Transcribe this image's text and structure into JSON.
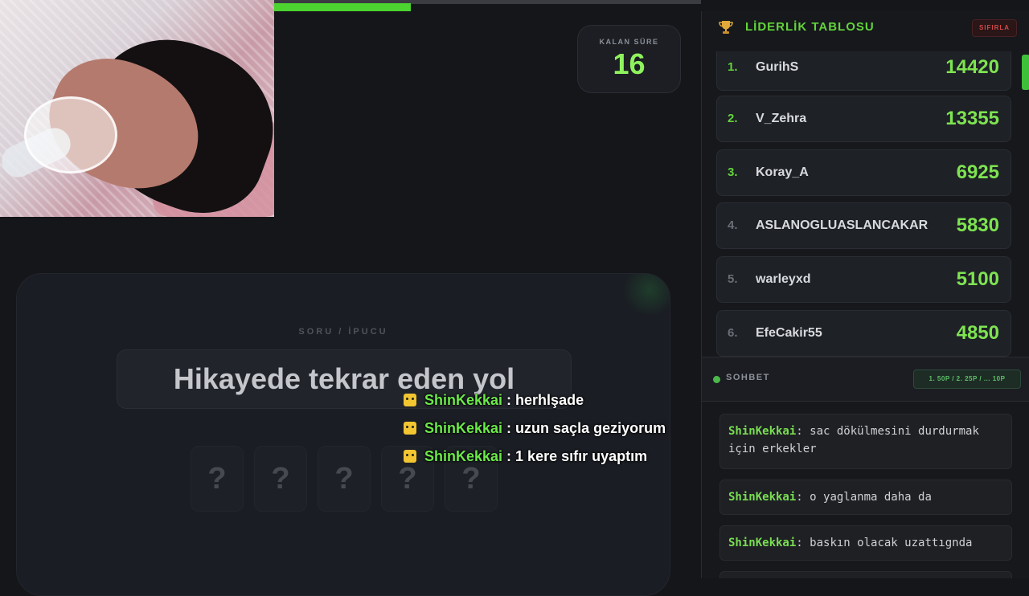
{
  "progress": {
    "fraction": 0.32
  },
  "timer": {
    "label": "KALAN SÜRE",
    "value": "16"
  },
  "question": {
    "label": "SORU / İPUCU",
    "text": "Hikayede tekrar eden yol",
    "tiles": [
      "?",
      "?",
      "?",
      "?",
      "?"
    ]
  },
  "overlay_chat": [
    {
      "user": "ShinKekkai",
      "sep": " : ",
      "message": "herhlşade"
    },
    {
      "user": "ShinKekkai",
      "sep": " : ",
      "message": "uzun saçla geziyorum"
    },
    {
      "user": "ShinKekkai",
      "sep": " : ",
      "message": "1 kere sıfır uyaptım"
    }
  ],
  "leaderboard": {
    "title": "LİDERLİK TABLOSU",
    "reset_label": "SIFIRLA",
    "rows": [
      {
        "rank": "1.",
        "name": "GurihS",
        "score": "14420"
      },
      {
        "rank": "2.",
        "name": "V_Zehra",
        "score": "13355"
      },
      {
        "rank": "3.",
        "name": "Koray_A",
        "score": "6925"
      },
      {
        "rank": "4.",
        "name": "ASLANOGLUASLANCAKAR",
        "score": "5830"
      },
      {
        "rank": "5.",
        "name": "warleyxd",
        "score": "5100"
      },
      {
        "rank": "6.",
        "name": "EfeCakir55",
        "score": "4850"
      }
    ]
  },
  "chat": {
    "title": "SOHBET",
    "points_info": "1. 50P / 2. 25P / ... 10P",
    "messages": [
      {
        "user": "ShinKekkai",
        "message": ": sac dökülmesini durdurmak için erkekler"
      },
      {
        "user": "ShinKekkai",
        "message": ": o yaglanma daha da"
      },
      {
        "user": "ShinKekkai",
        "message": ": baskın olacak uzattıgnda"
      }
    ]
  },
  "colors": {
    "accent_green": "#6be84a",
    "background": "#151619",
    "danger": "#d14a4a"
  }
}
